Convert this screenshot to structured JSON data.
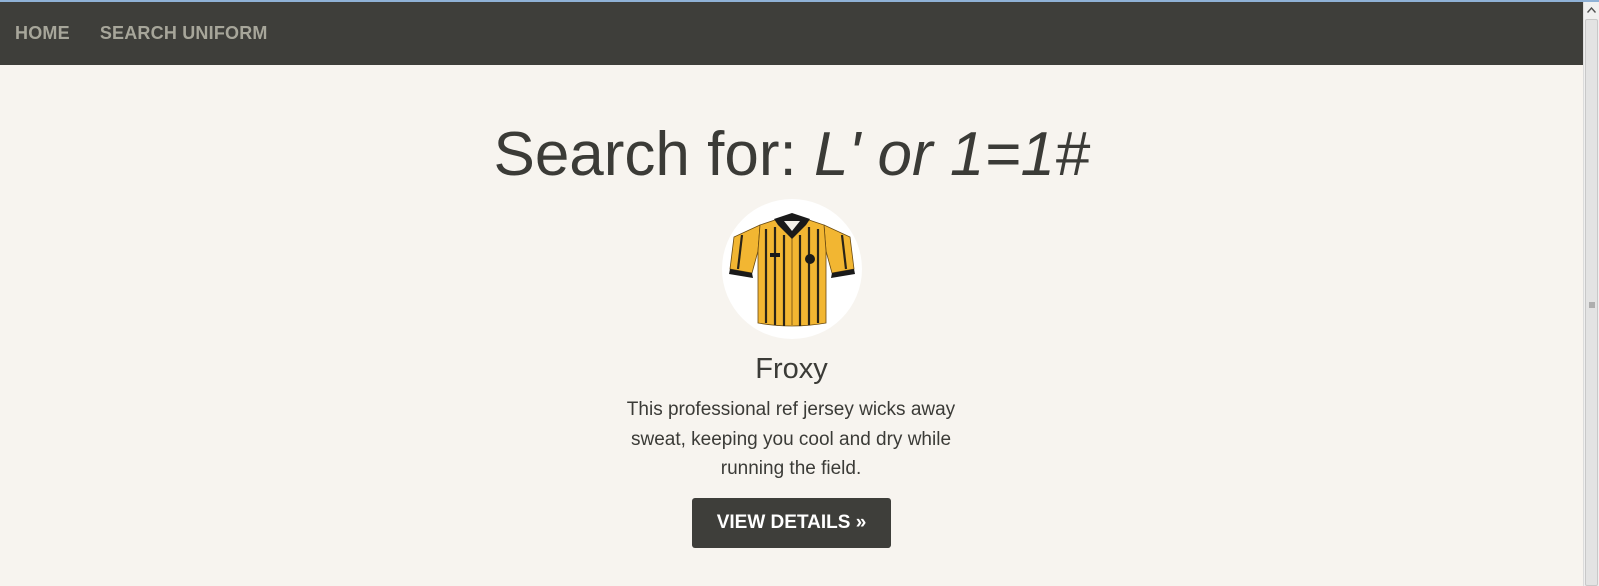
{
  "nav": {
    "home_label": "HOME",
    "search_label": "SEARCH UNIFORM"
  },
  "search": {
    "prefix": "Search for: ",
    "query": "L' or 1=1#"
  },
  "result": {
    "image_icon": "referee-jersey-image",
    "name": "Froxy",
    "description": "This professional ref jersey wicks away sweat, keeping you cool and dry while running the field.",
    "button_label": "VIEW DETAILS »"
  },
  "colors": {
    "navbar_bg": "#3e3e3a",
    "nav_link": "#a7a69a",
    "page_bg": "#f7f4ef",
    "text": "#3b3b37",
    "button_bg": "#3e3e3a",
    "button_text": "#ffffff",
    "jersey_yellow": "#f2b632"
  }
}
